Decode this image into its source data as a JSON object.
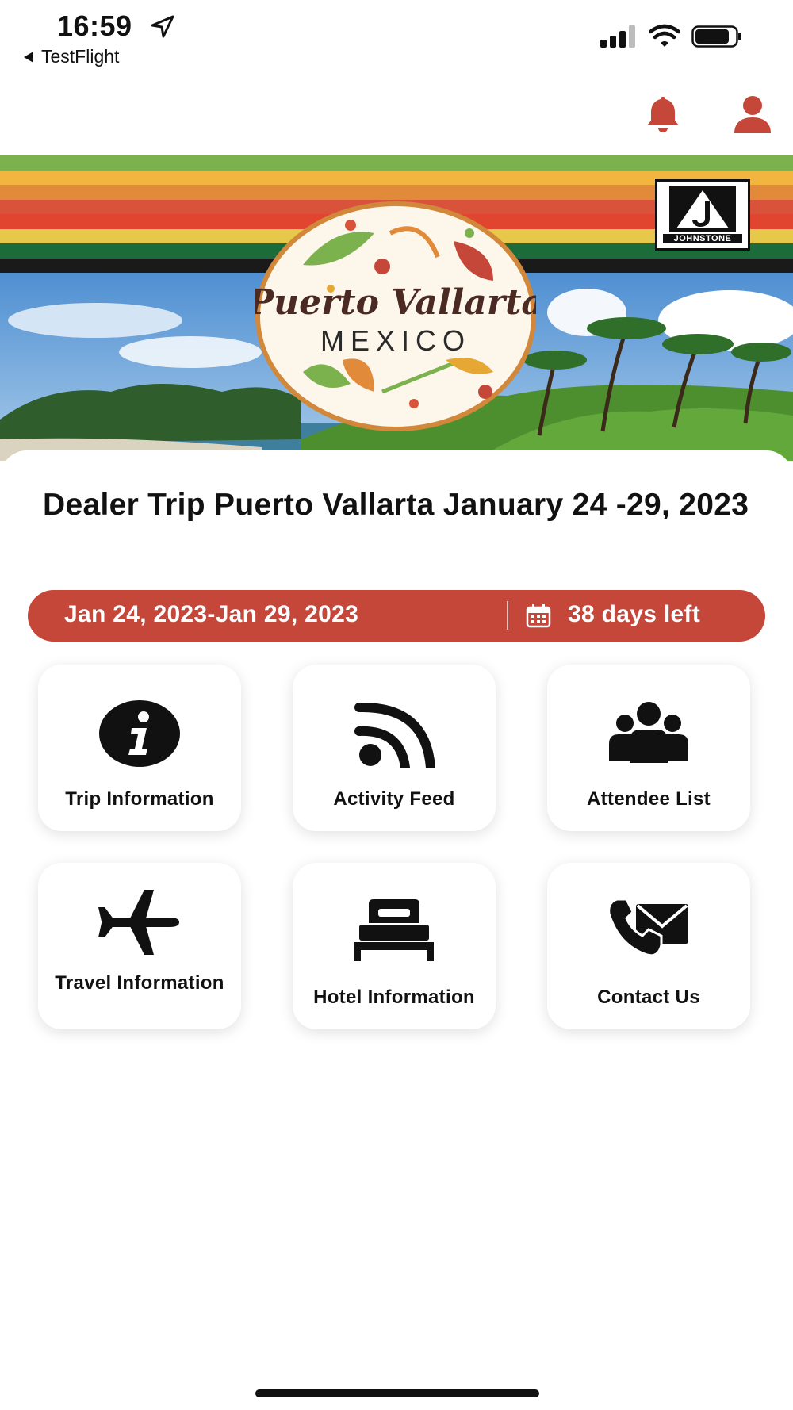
{
  "status_bar": {
    "time": "16:59",
    "back_label": "TestFlight",
    "icons": [
      "location-arrow-icon",
      "signal-icon",
      "wifi-icon",
      "battery-icon"
    ]
  },
  "header": {
    "icons": [
      "bell-icon",
      "user-icon"
    ],
    "accent_color": "#c5473a"
  },
  "hero": {
    "logo_script": "Puerto Vallarta",
    "logo_subtitle": "MEXICO",
    "brand_name": "JOHNSTONE",
    "stripe_colors": [
      "#7cb24e",
      "#f1b540",
      "#e08a3a",
      "#d9533a",
      "#e14530",
      "#e6c84a",
      "#1c6b3a",
      "#1a1a1a"
    ]
  },
  "trip": {
    "title": "Dealer Trip Puerto Vallarta January 24 -29, 2023",
    "date_range": "Jan 24, 2023-Jan 29, 2023",
    "days_left": "38 days left",
    "pill_color": "#c5473a"
  },
  "tiles": [
    {
      "label": "Trip Information",
      "icon": "info-icon"
    },
    {
      "label": "Activity Feed",
      "icon": "feed-icon"
    },
    {
      "label": "Attendee List",
      "icon": "people-icon"
    },
    {
      "label": "Travel Information",
      "icon": "airplane-icon"
    },
    {
      "label": "Hotel Information",
      "icon": "bed-icon"
    },
    {
      "label": "Contact Us",
      "icon": "phone-envelope-icon"
    }
  ]
}
